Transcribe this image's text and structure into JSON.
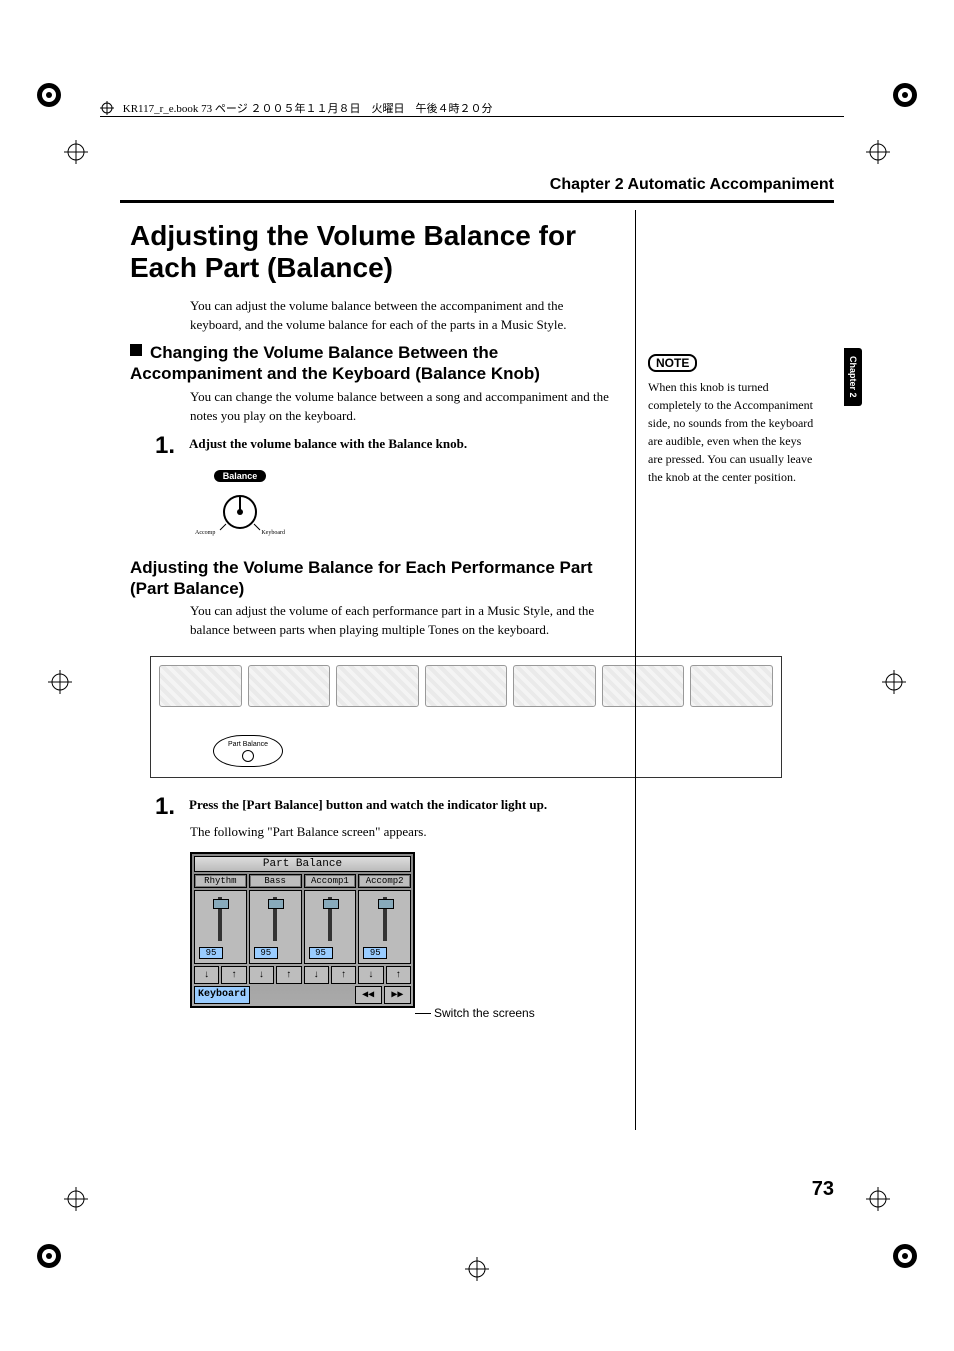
{
  "header": {
    "crop_info": "KR117_r_e.book 73 ページ ２００５年１１月８日　火曜日　午後４時２０分"
  },
  "chapter_header": "Chapter 2 Automatic Accompaniment",
  "side_tab": "Chapter 2",
  "title": "Adjusting the Volume Balance for Each Part (Balance)",
  "intro": "You can adjust the volume balance between the accompaniment and the keyboard, and the volume balance for each of the parts in a Music Style.",
  "sub1": {
    "heading": "Changing the Volume Balance Between the Accompaniment and the Keyboard (Balance Knob)",
    "body": "You can change the volume balance between a song and accompaniment and the notes you play on the keyboard.",
    "step_num": "1.",
    "step_text": "Adjust the volume balance with the Balance knob.",
    "knob_label": "Balance",
    "knob_left": "Accomp",
    "knob_right": "Keyboard"
  },
  "sub2": {
    "heading": "Adjusting the Volume Balance for Each Performance Part (Part Balance)",
    "body": "You can adjust the volume of each performance part in a Music Style, and the balance between parts when playing multiple Tones on the keyboard.",
    "panel_callout": "Part Balance",
    "step_num": "1.",
    "step_text": "Press the [Part Balance] button and watch the indicator light up.",
    "step_sub": "The following \"Part Balance screen\" appears."
  },
  "lcd": {
    "title": "Part Balance",
    "tabs": [
      "Rhythm",
      "Bass",
      "Accomp1",
      "Accomp2"
    ],
    "values": [
      "95",
      "95",
      "95",
      "95"
    ],
    "down_glyph": "↓",
    "up_glyph": "↑",
    "keyboard_label": "Keyboard",
    "prev_glyph": "◀◀",
    "next_glyph": "▶▶",
    "callout": "Switch the screens"
  },
  "note": {
    "label": "NOTE",
    "body": "When this knob is turned completely to the Accompaniment side, no sounds from the keyboard are audible, even when the keys are pressed. You can usually leave the knob at the center position."
  },
  "page_number": "73"
}
